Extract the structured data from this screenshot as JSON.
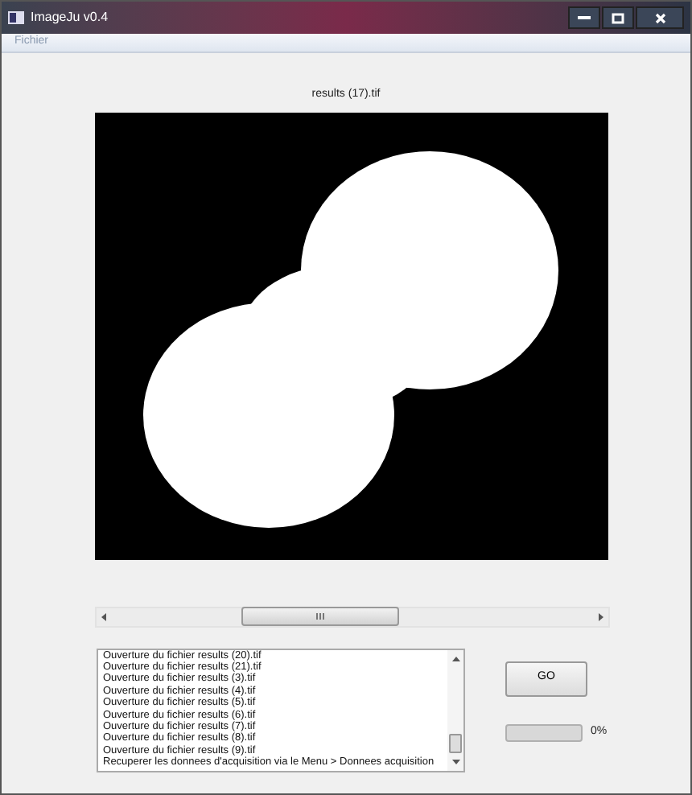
{
  "window": {
    "title": "ImageJu v0.4"
  },
  "menu": [
    "Fichier"
  ],
  "image_title": "results (17).tif",
  "log": [
    "Ouverture du fichier results (20).tif",
    "Ouverture du fichier results (21).tif",
    "Ouverture du fichier results (3).tif",
    "Ouverture du fichier results (4).tif",
    "Ouverture du fichier results (5).tif",
    "Ouverture du fichier results (6).tif",
    "Ouverture du fichier results (7).tif",
    "Ouverture du fichier results (8).tif",
    "Ouverture du fichier results (9).tif",
    "Recuperer les donnees d'acquisition via le Menu > Donnees acquisition"
  ],
  "go_button": "GO",
  "progress": {
    "level": 0,
    "reading": "0%"
  }
}
